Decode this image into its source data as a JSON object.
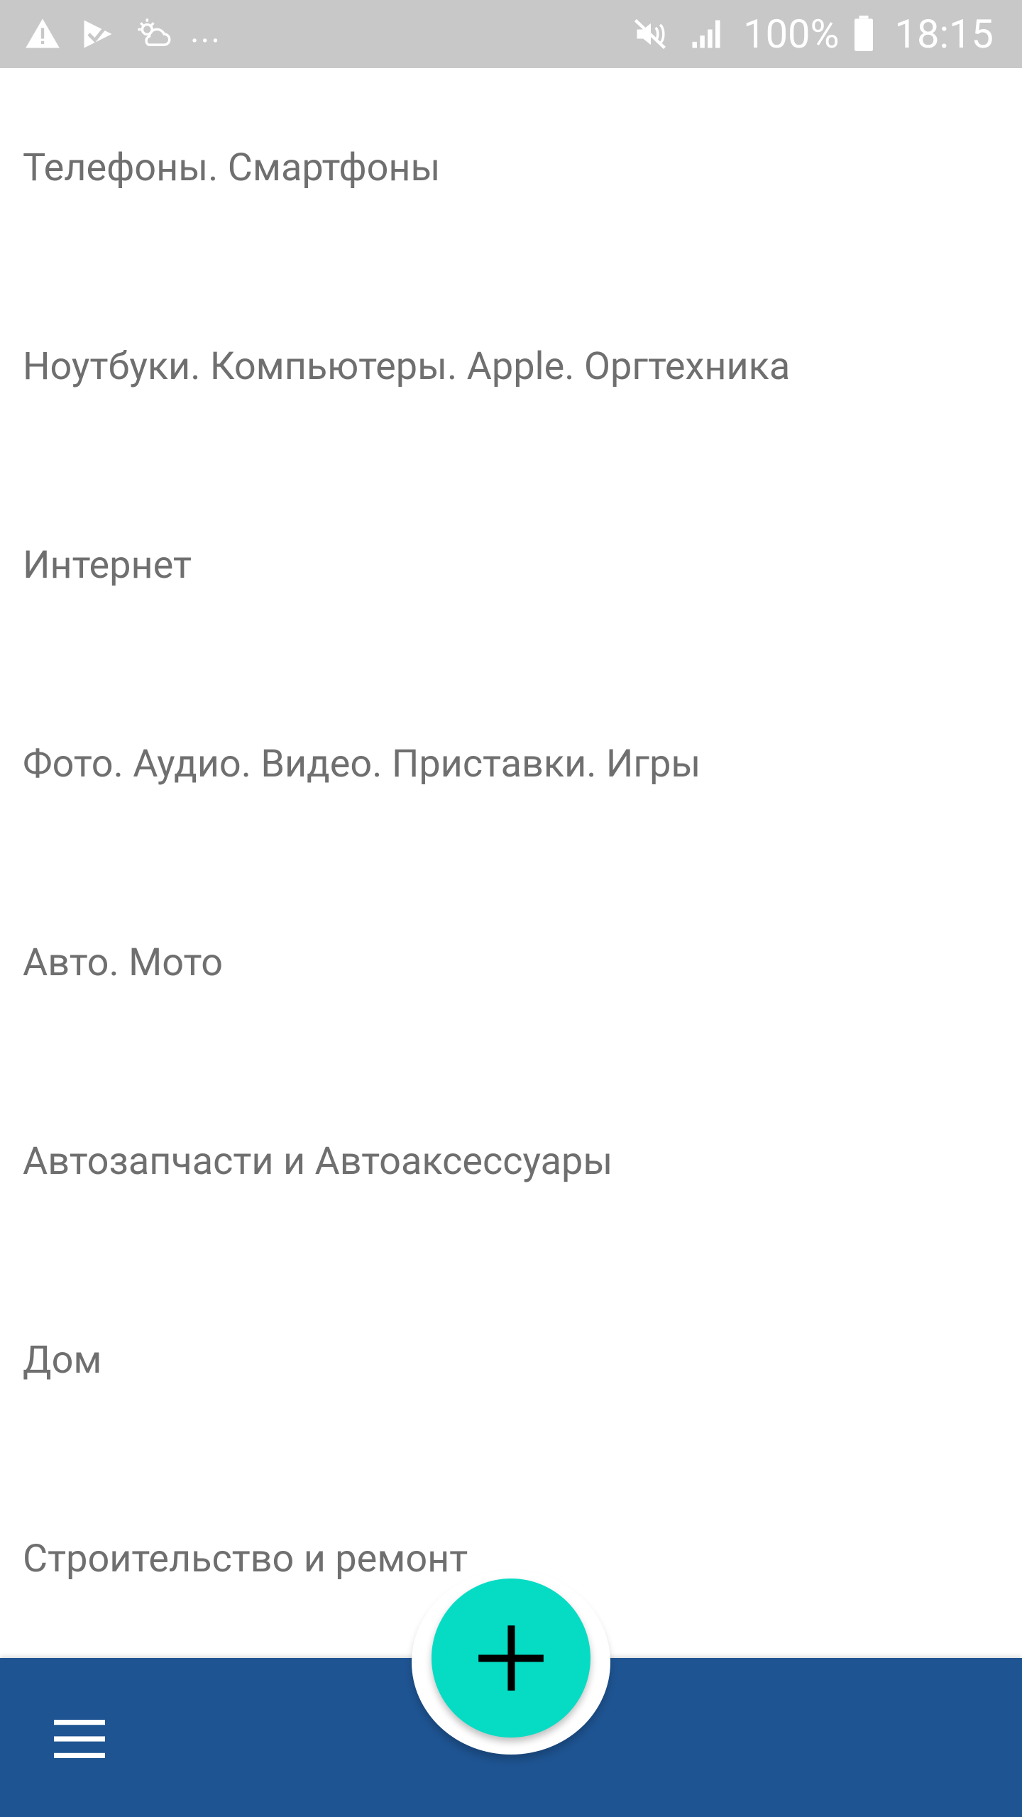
{
  "status_bar": {
    "overflow_dots": "...",
    "battery_percent": "100%",
    "time": "18:15",
    "icons": [
      "warning-icon",
      "checkmark-flag-icon",
      "weather-icon",
      "mute-vibrate-icon",
      "signal-icon",
      "battery-icon"
    ]
  },
  "categories": [
    {
      "label": "Телефоны. Смартфоны"
    },
    {
      "label": "Ноутбуки. Компьютеры. Apple. Оргтехника"
    },
    {
      "label": "Интернет"
    },
    {
      "label": "Фото. Аудио. Видео. Приставки. Игры"
    },
    {
      "label": "Авто. Мото"
    },
    {
      "label": "Автозапчасти и Автоаксессуары"
    },
    {
      "label": "Дом"
    },
    {
      "label": "Строительство и ремонт"
    }
  ],
  "bottom_bar": {
    "menu_icon": "hamburger-menu-icon",
    "fab_icon": "plus-icon"
  },
  "colors": {
    "status_bar": "#c8c8c8",
    "bottom_bar": "#1e5492",
    "fab": "#06dcc4",
    "list_text": "#6f6f6f"
  }
}
